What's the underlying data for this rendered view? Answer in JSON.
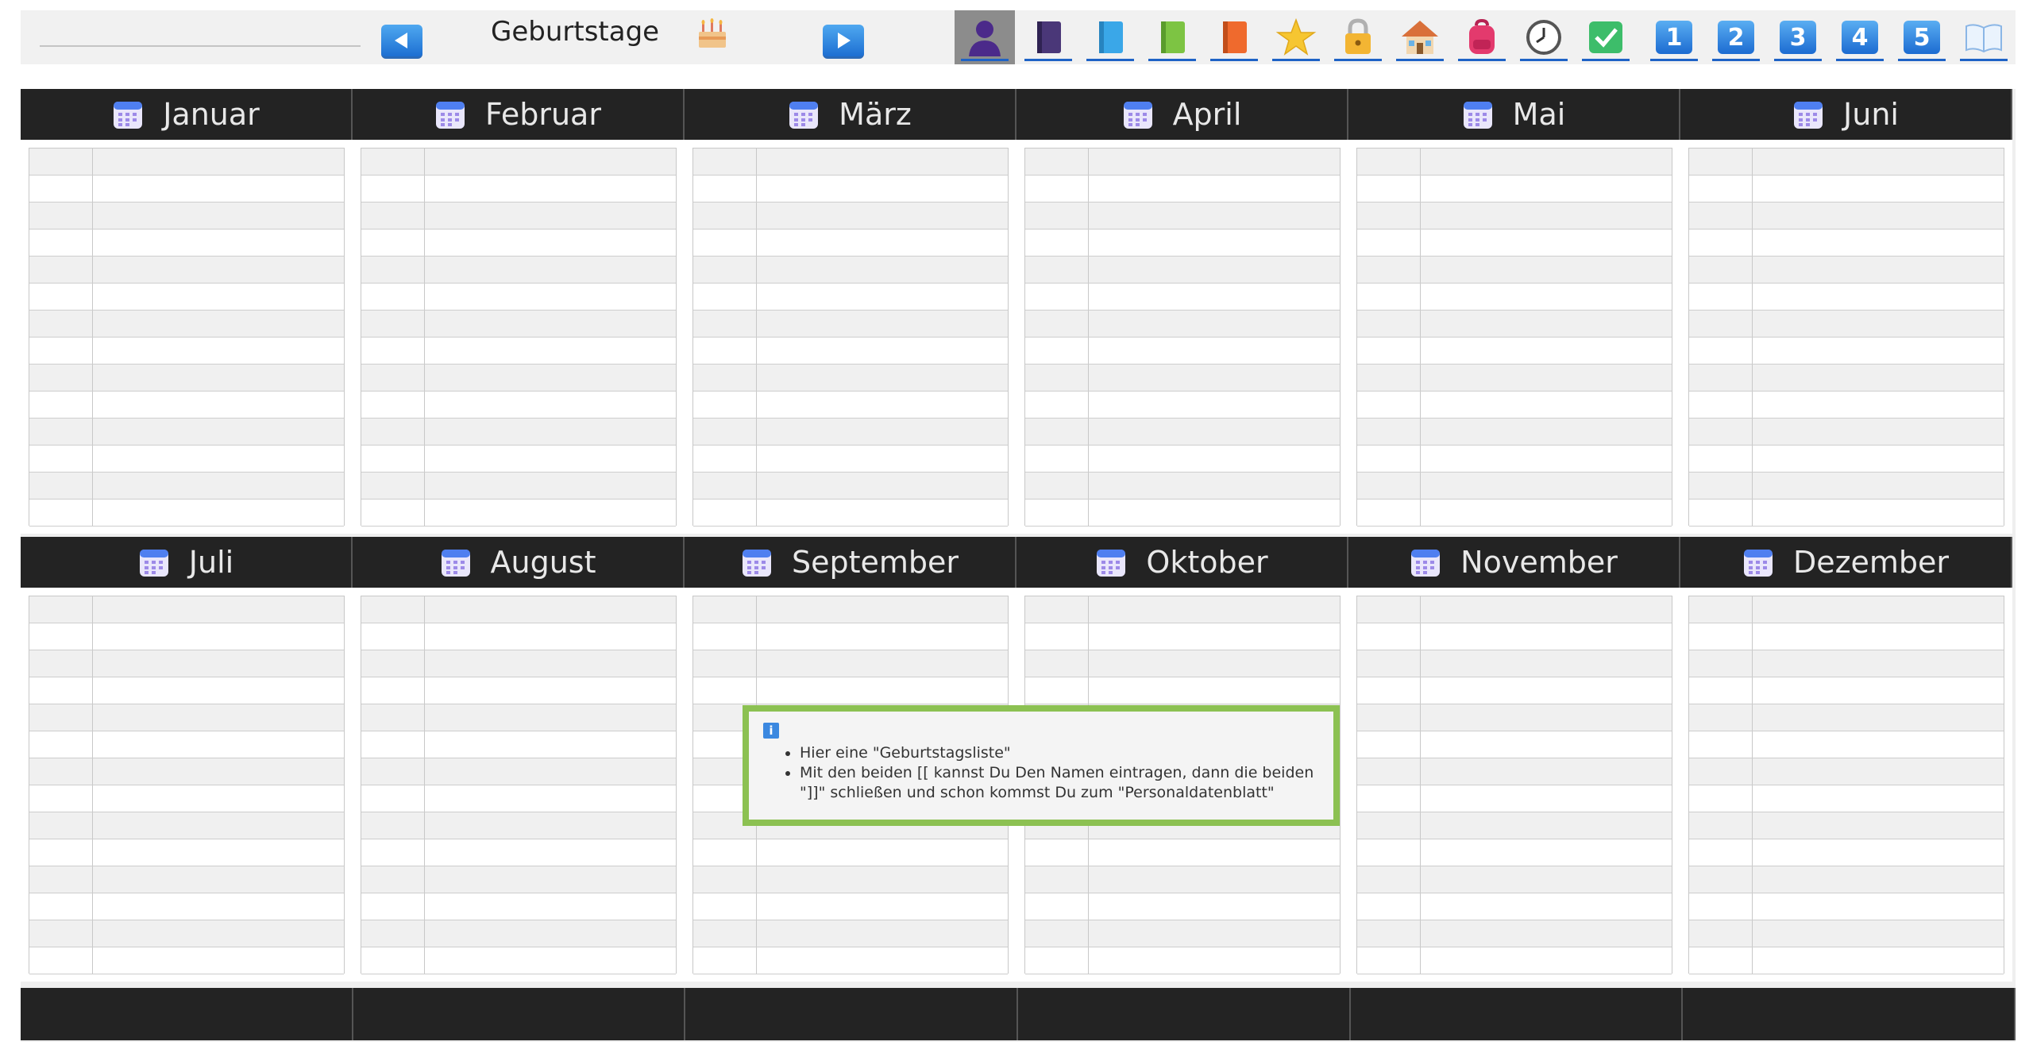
{
  "header": {
    "title": "Geburtstage",
    "prev_icon": "arrow-left-icon",
    "next_icon": "arrow-right-icon",
    "title_icon": "cake-icon",
    "toolbar_icons": [
      {
        "name": "person-icon",
        "active": true
      },
      {
        "name": "purple-book-icon"
      },
      {
        "name": "blue-book-icon"
      },
      {
        "name": "green-book-icon"
      },
      {
        "name": "orange-book-icon"
      },
      {
        "name": "star-icon"
      },
      {
        "name": "lock-icon"
      },
      {
        "name": "house-icon"
      },
      {
        "name": "backpack-icon"
      },
      {
        "name": "clock-icon"
      },
      {
        "name": "checkmark-icon"
      }
    ],
    "number_icons": [
      "1",
      "2",
      "3",
      "4",
      "5"
    ],
    "last_icon": "open-book-icon"
  },
  "months": [
    "Januar",
    "Februar",
    "März",
    "April",
    "Mai",
    "Juni",
    "Juli",
    "August",
    "September",
    "Oktober",
    "November",
    "Dezember"
  ],
  "tooltip": {
    "icon": "info-icon",
    "icon_label": "i",
    "line1": "Hier eine \"Geburtstagsliste\"",
    "line2": "Mit den beiden [[ kannst Du Den Namen eintragen, dann die beiden \"]]\" schließen und schon kommst Du zum \"Personaldatenblatt\""
  },
  "colors": {
    "header_dark": "#232323",
    "accent_blue": "#1e63c6",
    "tooltip_border": "#8cc152"
  }
}
